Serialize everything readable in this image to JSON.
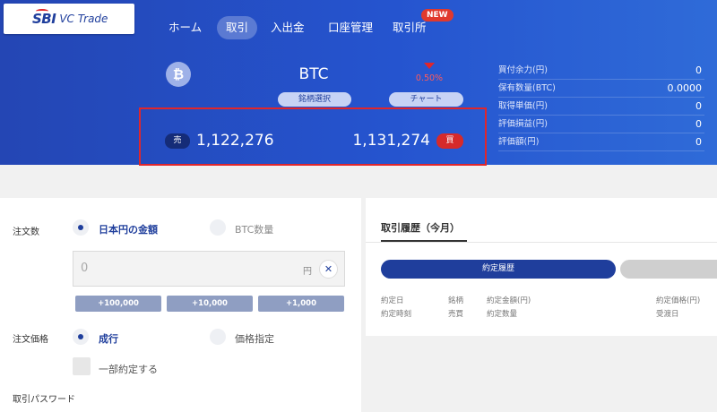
{
  "logo": {
    "brand": "SBI",
    "product": "VC Trade"
  },
  "nav": {
    "items": [
      "ホーム",
      "取引",
      "入出金",
      "口座管理",
      "取引所"
    ],
    "active": "取引",
    "new_badge": "NEW"
  },
  "ticker": {
    "icon": "bitcoin-icon",
    "symbol": "BTC",
    "select_button": "銘柄選択",
    "chart_button": "チャート",
    "change": "0.50%",
    "change_direction": "down"
  },
  "quote": {
    "sell_label": "売",
    "sell_price": "1,122,276",
    "buy_price": "1,131,274",
    "buy_label": "買"
  },
  "account": [
    {
      "label": "買付余力(円)",
      "value": "0"
    },
    {
      "label": "保有数量(BTC)",
      "value": "0.0000"
    },
    {
      "label": "取得単価(円)",
      "value": "0"
    },
    {
      "label": "評価損益(円)",
      "value": "0"
    },
    {
      "label": "評価額(円)",
      "value": "0"
    }
  ],
  "order": {
    "quantity_label": "注文数",
    "quantity_options": [
      "日本円の金額",
      "BTC数量"
    ],
    "quantity_selected": "日本円の金額",
    "amount_value": "0",
    "amount_unit": "円",
    "clear_icon": "close-icon",
    "increments": [
      "+100,000",
      "+10,000",
      "+1,000"
    ],
    "price_label": "注文価格",
    "price_options": [
      "成行",
      "価格指定"
    ],
    "price_selected": "成行",
    "partial_fill": "一部約定する",
    "password_label": "取引パスワード"
  },
  "history": {
    "tab": "取引履歴（今月）",
    "segment_active": "約定履歴",
    "columns_row1": [
      "約定日",
      "銘柄",
      "約定金額(円)",
      "約定価格(円)"
    ],
    "columns_row2": [
      "約定時刻",
      "売買",
      "約定数量",
      "受渡日"
    ]
  },
  "colors": {
    "header_blue": "#2554cf",
    "accent_navy": "#1f3e9c",
    "sell_tag": "#152c78",
    "buy_tag": "#d62a2a",
    "highlight_box": "#e0262b",
    "change_negative": "#ff5a5a"
  }
}
